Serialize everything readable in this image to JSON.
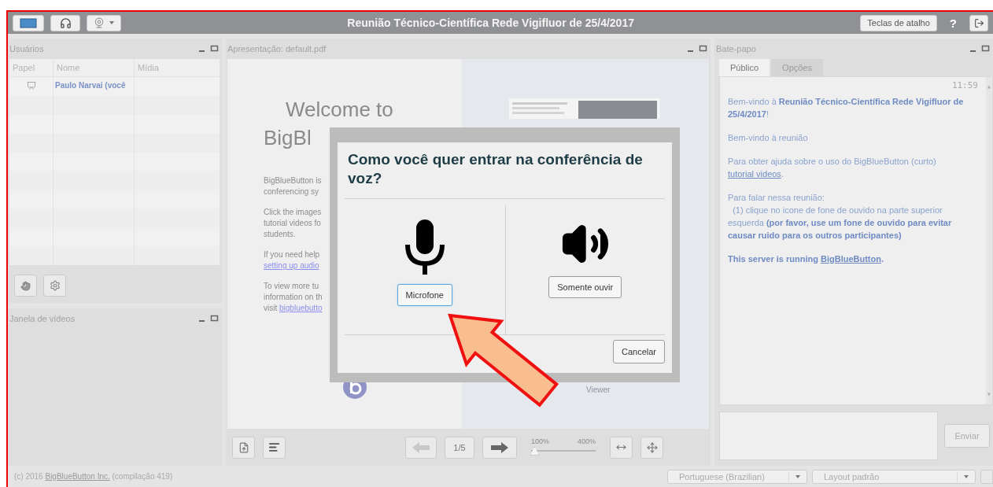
{
  "top_bar": {
    "title": "Reunião Técnico-Científica Rede Vigifluor de 25/4/2017",
    "shortcuts_button": "Teclas de atalho",
    "help_button": "?"
  },
  "users_panel": {
    "title": "Usuários",
    "columns": [
      "Papel",
      "Nome",
      "Mídia"
    ],
    "rows": [
      {
        "name": "Paulo Narvai (você",
        "presenter": true
      }
    ]
  },
  "video_panel": {
    "title": "Janela de vídeos"
  },
  "presentation": {
    "title": "Apresentação: default.pdf",
    "slide": {
      "heading_lines": [
        "Welcome to",
        "BigBl"
      ],
      "paragraphs": [
        [
          {
            "text": "BigBlueButton is"
          },
          {
            "text": "conferencing sy"
          }
        ],
        [
          {
            "text": "Click the images"
          },
          {
            "text": "tutorial videos fo"
          },
          {
            "text": "students."
          }
        ],
        [
          {
            "text": "If you need help"
          },
          {
            "link": "setting up audio"
          }
        ],
        [
          {
            "text": "To view more tu"
          },
          {
            "text": "information on th"
          },
          {
            "text": "visit ",
            "link": "bigbluebutto"
          }
        ]
      ],
      "caption": "Viewer"
    },
    "prev": {
      "disabled": true
    },
    "next": {
      "disabled": false
    },
    "page": "1/5",
    "zoom": {
      "min_label": "100%",
      "max_label": "400%",
      "level": 0
    }
  },
  "chat": {
    "title": "Bate-papo",
    "tabs": [
      {
        "label": "Público",
        "selected": true
      },
      {
        "label": "Opções",
        "selected": false
      }
    ],
    "time": "11:59",
    "messages": [
      {
        "text": "Bem-vindo à **Reunião Técnico-Científica Rede Vigifluor de 25/4/2017**!"
      },
      {
        "text": "Bem-vindo à reunião"
      },
      {
        "text": "Para obter ajuda sobre o uso do BigBlueButton (curto) ",
        "link": "tutorial videos",
        "after": "."
      },
      {
        "text": "Para falar nessa reunião:\n  (1) clique no icone de fone de ouvido na parte superior esquerda **(por favor, use um fone de ouvido para evitar causar ruido para os outros participantes)**"
      },
      {
        "text": "This server is running ",
        "link": "BigBlueButton",
        "after": ".",
        "bold": true
      }
    ],
    "send_button": "Enviar"
  },
  "footer": {
    "copyright": "(c) 2016 ",
    "link": "BigBlueButton Inc.",
    "build": " (compilação 419)",
    "language": "Portuguese (Brazilian)",
    "layout": "Layout padrão"
  },
  "dialog": {
    "title": "Como você quer entrar na conferência de voz?",
    "options": [
      {
        "kind": "microphone",
        "label": "Microfone",
        "selected": true
      },
      {
        "kind": "listen",
        "label": "Somente ouvir",
        "selected": false
      }
    ],
    "cancel": "Cancelar"
  }
}
